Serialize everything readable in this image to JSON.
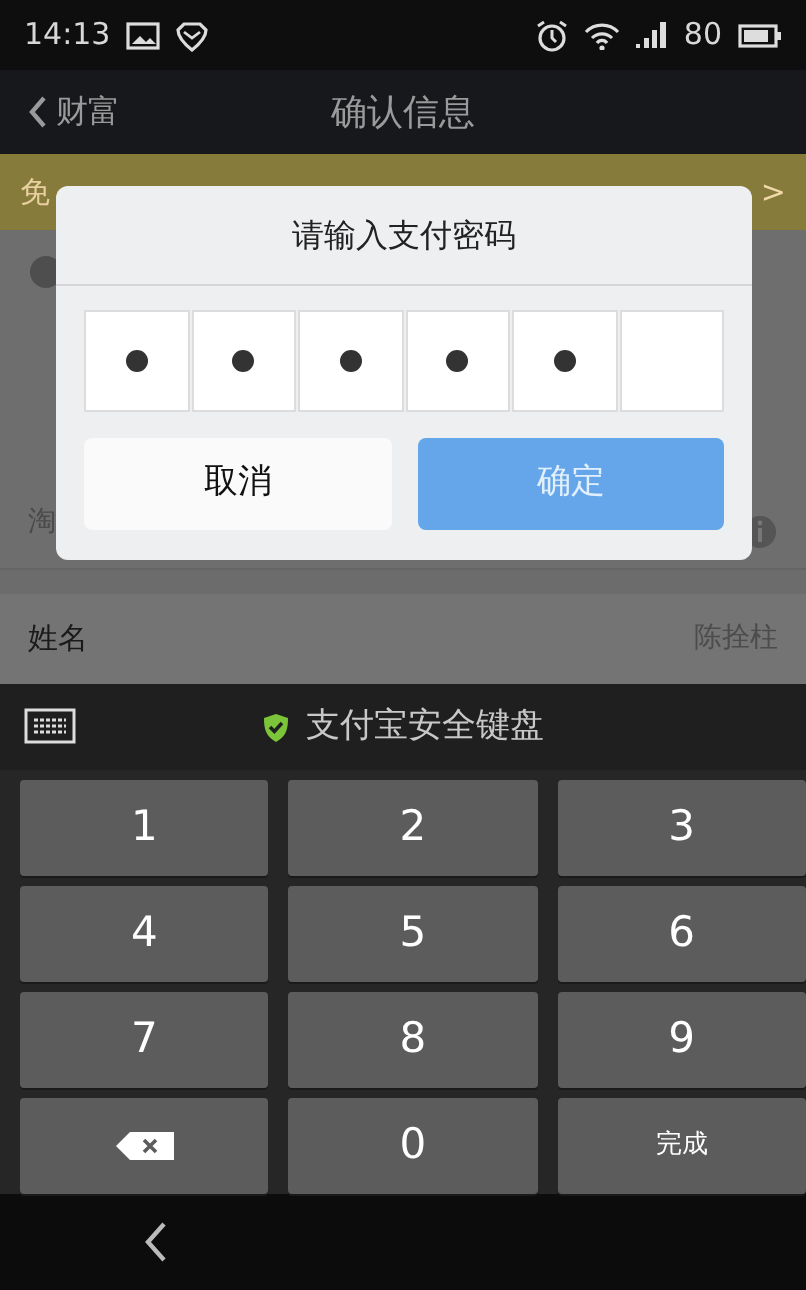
{
  "status_bar": {
    "time": "14:13",
    "battery": "80"
  },
  "nav": {
    "back_label": "财富",
    "title": "确认信息"
  },
  "banner": {
    "text": "免",
    "arrow": ">"
  },
  "background": {
    "row_label": "淘",
    "name_label": "姓名",
    "name_value": "陈拴柱"
  },
  "dialog": {
    "title": "请输入支付密码",
    "cells": [
      {
        "filled": true
      },
      {
        "filled": true
      },
      {
        "filled": true
      },
      {
        "filled": true
      },
      {
        "filled": true
      },
      {
        "filled": false
      }
    ],
    "cancel": {
      "label": "取消"
    },
    "confirm": {
      "label": "确定",
      "disabled": true
    }
  },
  "keyboard": {
    "title": "支付宝安全键盘",
    "keys": [
      {
        "kind": "digit",
        "label": "1"
      },
      {
        "kind": "digit",
        "label": "2"
      },
      {
        "kind": "digit",
        "label": "3"
      },
      {
        "kind": "digit",
        "label": "4"
      },
      {
        "kind": "digit",
        "label": "5"
      },
      {
        "kind": "digit",
        "label": "6"
      },
      {
        "kind": "digit",
        "label": "7"
      },
      {
        "kind": "digit",
        "label": "8"
      },
      {
        "kind": "digit",
        "label": "9"
      },
      {
        "kind": "delete"
      },
      {
        "kind": "digit",
        "label": "0"
      },
      {
        "kind": "done",
        "label": "完成"
      }
    ]
  }
}
